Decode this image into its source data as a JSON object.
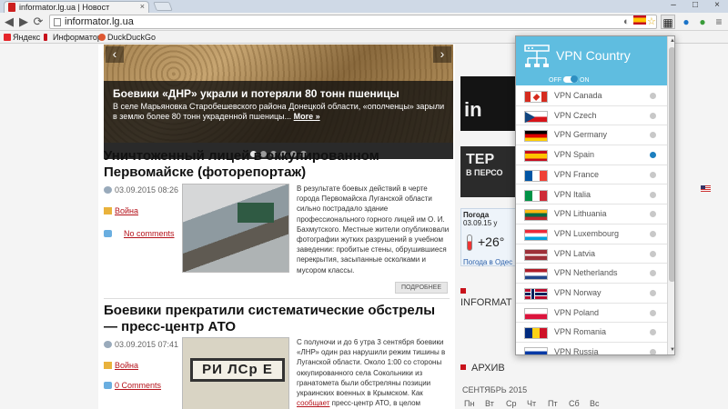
{
  "browser": {
    "tab_title": "informator.lg.ua | Новост",
    "address": "informator.lg.ua",
    "bookmarks": [
      {
        "label": "Яндекс",
        "color": "#e5262b"
      },
      {
        "label": "Информатор",
        "color": "#c8121b"
      },
      {
        "label": "DuckDuckGo",
        "color": "#de5833"
      }
    ]
  },
  "slider": {
    "title": "Боевики «ДНР» украли и потеряли 80 тонн пшеницы",
    "text": "В селе Марьяновка Старобешевского района Донецкой области, «ополченцы» зарыли в землю более 80 тонн украденной пшеницы...",
    "more_label": "More »",
    "dots_total": 6,
    "dots_active": 0
  },
  "articles": [
    {
      "title": "Уничтоженный лицей в оккупированном Первомайске (фоторепортаж)",
      "date": "03.09.2015 08:26",
      "category": "Война",
      "comments": "No comments",
      "text": "В результате боевых действий в черте города Первомайска Луганской области сильно пострадало здание профессионального горного лицей им О. И. Бахмутского. Местные жители опубликовали фотографии жутких разрушений в учебном заведении: пробитые стены, обрушившиеся перекрытия, засыпанные осколками и мусором классы.",
      "more_label": "ПОДРОБНЕЕ"
    },
    {
      "title": "Боевики прекратили систематические обстрелы — пресс-центр АТО",
      "date": "03.09.2015 07:41",
      "category": "Война",
      "comments": "0 Comments",
      "text_before_link": "С полуночи и до 6 утра 3 сентября боевики «ЛНР» один раз нарушили режим тишины в Луганской области. Около 1:00 со стороны оккупированного села Сокольники из гранатомета были обстреляны позиции украинских военных в Крымском. Как ",
      "text_link": "сообщает",
      "text_after_link": " пресс-центр АТО, в целом",
      "sign_text": "РИ ЛСр Е"
    }
  ],
  "right": {
    "ad1_text": "in",
    "ad2_big": "ТЕР",
    "ad2_small": "В ПЕРСО",
    "weather_label": "Погода",
    "weather_date": "03.09.15 у",
    "weather_temp": "+26°",
    "weather_loc": "Погода в Одес",
    "informator_head": "INFORMAT",
    "archive_head": "АРХИВ",
    "cal_month": "СЕНТЯБРЬ 2015",
    "cal_days": [
      "Пн",
      "Вт",
      "Ср",
      "Чт",
      "Пт",
      "Сб",
      "Вс"
    ]
  },
  "vpn": {
    "title": "VPN Country",
    "toggle_off": "OFF",
    "toggle_on": "ON",
    "header_color": "#5fbde0",
    "selected": "VPN Spain",
    "countries": [
      {
        "label": "VPN Canada",
        "flag": "f-ca"
      },
      {
        "label": "VPN Czech",
        "flag": "f-cz"
      },
      {
        "label": "VPN Germany",
        "flag": "f-de"
      },
      {
        "label": "VPN Spain",
        "flag": "f-es"
      },
      {
        "label": "VPN France",
        "flag": "f-fr"
      },
      {
        "label": "VPN Italia",
        "flag": "f-it"
      },
      {
        "label": "VPN Lithuania",
        "flag": "f-lt"
      },
      {
        "label": "VPN Luxembourg",
        "flag": "f-lu"
      },
      {
        "label": "VPN Latvia",
        "flag": "f-lv"
      },
      {
        "label": "VPN Netherlands",
        "flag": "f-nl"
      },
      {
        "label": "VPN Norway",
        "flag": "f-no"
      },
      {
        "label": "VPN Poland",
        "flag": "f-pl"
      },
      {
        "label": "VPN Romania",
        "flag": "f-ro"
      },
      {
        "label": "VPN Russia",
        "flag": "f-ru"
      }
    ]
  },
  "icons": {
    "back": "◀",
    "forward": "▶",
    "reload": "⟳",
    "star": "☆",
    "close": "×",
    "minimize": "–",
    "maximize": "□"
  }
}
